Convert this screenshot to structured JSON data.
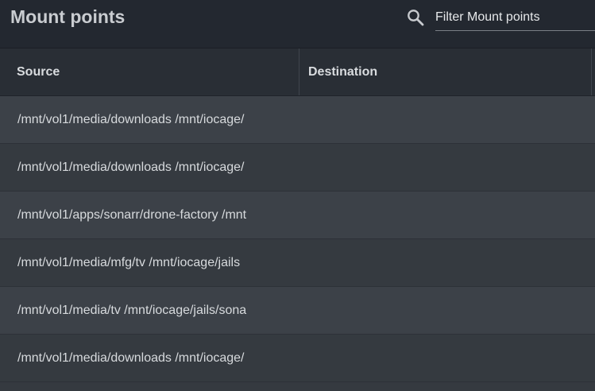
{
  "header": {
    "title": "Mount points",
    "search_icon": "search-icon",
    "filter_placeholder": "Filter Mount points",
    "filter_value": ""
  },
  "table": {
    "columns": [
      "Source",
      "Destination"
    ],
    "rows": [
      {
        "source": "/mnt/vol1/media/downloads /mnt/iocage/",
        "destination": ""
      },
      {
        "source": "/mnt/vol1/media/downloads /mnt/iocage/",
        "destination": ""
      },
      {
        "source": "/mnt/vol1/apps/sonarr/drone-factory /mnt",
        "destination": ""
      },
      {
        "source": "/mnt/vol1/media/mfg/tv /mnt/iocage/jails",
        "destination": ""
      },
      {
        "source": "/mnt/vol1/media/tv /mnt/iocage/jails/sona",
        "destination": ""
      },
      {
        "source": "/mnt/vol1/media/downloads /mnt/iocage/",
        "destination": ""
      }
    ]
  },
  "colors": {
    "background": "#353a40",
    "header_bg": "#232830",
    "row_alt": "#3c4148",
    "text": "#d7dadd"
  }
}
